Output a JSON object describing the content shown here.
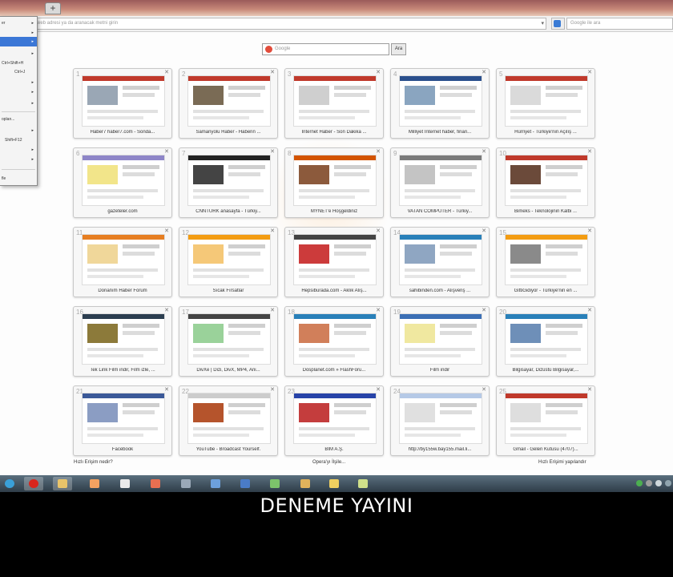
{
  "browser": {
    "new_tab_label": "+",
    "address_placeholder": "Bir web adresi ya da aranacak metni girin",
    "search_placeholder": "Google ile ara"
  },
  "menu": {
    "items": [
      {
        "label": "er",
        "shortcut": ""
      },
      {
        "label": "",
        "shortcut": ""
      },
      {
        "label": "",
        "shortcut": ""
      },
      {
        "label": "",
        "shortcut": ""
      },
      {
        "label": "",
        "shortcut": "Ctrl+Shift+H"
      },
      {
        "label": "",
        "shortcut": "Ctrl+J"
      },
      {
        "label": "",
        "shortcut": ""
      },
      {
        "label": "",
        "shortcut": ""
      },
      {
        "label": "",
        "shortcut": ""
      },
      {
        "label": "oplan...",
        "shortcut": ""
      },
      {
        "label": "",
        "shortcut": ""
      },
      {
        "label": "",
        "shortcut": "Shift+F12"
      },
      {
        "label": "",
        "shortcut": ""
      },
      {
        "label": "",
        "shortcut": ""
      },
      {
        "label": "fle",
        "shortcut": ""
      }
    ]
  },
  "speed_dial": {
    "search_placeholder": "Google",
    "search_button": "Ara",
    "tiles": [
      {
        "num": "1",
        "label": "Haber7 haber7.com - Sonda..."
      },
      {
        "num": "2",
        "label": "Samanyolu Haber - Haberin ..."
      },
      {
        "num": "3",
        "label": "İnternet Haber - Son Dakika ..."
      },
      {
        "num": "4",
        "label": "Milliyet İnternet haber, finan..."
      },
      {
        "num": "5",
        "label": "Hürriyet - Türkiye'nin Açılış ..."
      },
      {
        "num": "6",
        "label": "gazeteler.com"
      },
      {
        "num": "7",
        "label": "CNNTÜRK anasayfa - Türkiy..."
      },
      {
        "num": "8",
        "label": "MYNET'e Hoşgeldiniz"
      },
      {
        "num": "9",
        "label": "VATAN COMPUTER - Türkiy..."
      },
      {
        "num": "10",
        "label": "Bimeks - Teknolojinin Kalbi ..."
      },
      {
        "num": "11",
        "label": "Donanım Haber Forum"
      },
      {
        "num": "12",
        "label": "Sıcak Fırsatlar"
      },
      {
        "num": "13",
        "label": "Hepsiburada.com - Aklık Alış..."
      },
      {
        "num": "14",
        "label": "sahibinden.com - Alışveriş ..."
      },
      {
        "num": "15",
        "label": "GittiGidiyor - Türkiye'nin en ..."
      },
      {
        "num": "16",
        "label": "Tek Link Film indir, Film izle, ..."
      },
      {
        "num": "17",
        "label": "DivXe | Dizi, DivX, MP4, Ani..."
      },
      {
        "num": "18",
        "label": "Dosplanet.com » FlashForu..."
      },
      {
        "num": "19",
        "label": "Film indir"
      },
      {
        "num": "20",
        "label": "Bilgisayar, Dizüstü Bilgisayar,..."
      },
      {
        "num": "21",
        "label": "Facebook"
      },
      {
        "num": "22",
        "label": "YouTube - Broadcast Yourself."
      },
      {
        "num": "23",
        "label": "BİM A.Ş."
      },
      {
        "num": "24",
        "label": "http://by155w.bay155.mail.li..."
      },
      {
        "num": "25",
        "label": "Gmail - Gelen Kutusu (4707)..."
      }
    ],
    "bottom_left_link": "Hızlı Erişim nedir?",
    "bottom_center_link": "Opera'yı İlşile...",
    "bottom_right_link": "Hızlı Erişimi yapılandır"
  },
  "colors": {
    "menu_highlight": "#3b77d6",
    "taskbar": "#2f3d48",
    "opera_red": "#d9251c"
  },
  "taskbar": {
    "icons": [
      "start-orb-icon",
      "opera-icon",
      "explorer-folder-icon",
      "media-player-icon",
      "game-icon",
      "app-icon",
      "app-icon",
      "app-icon",
      "app-icon",
      "app-icon",
      "app-icon",
      "folder-icon",
      "app-icon"
    ]
  },
  "caption": "DENEME YAYINI"
}
